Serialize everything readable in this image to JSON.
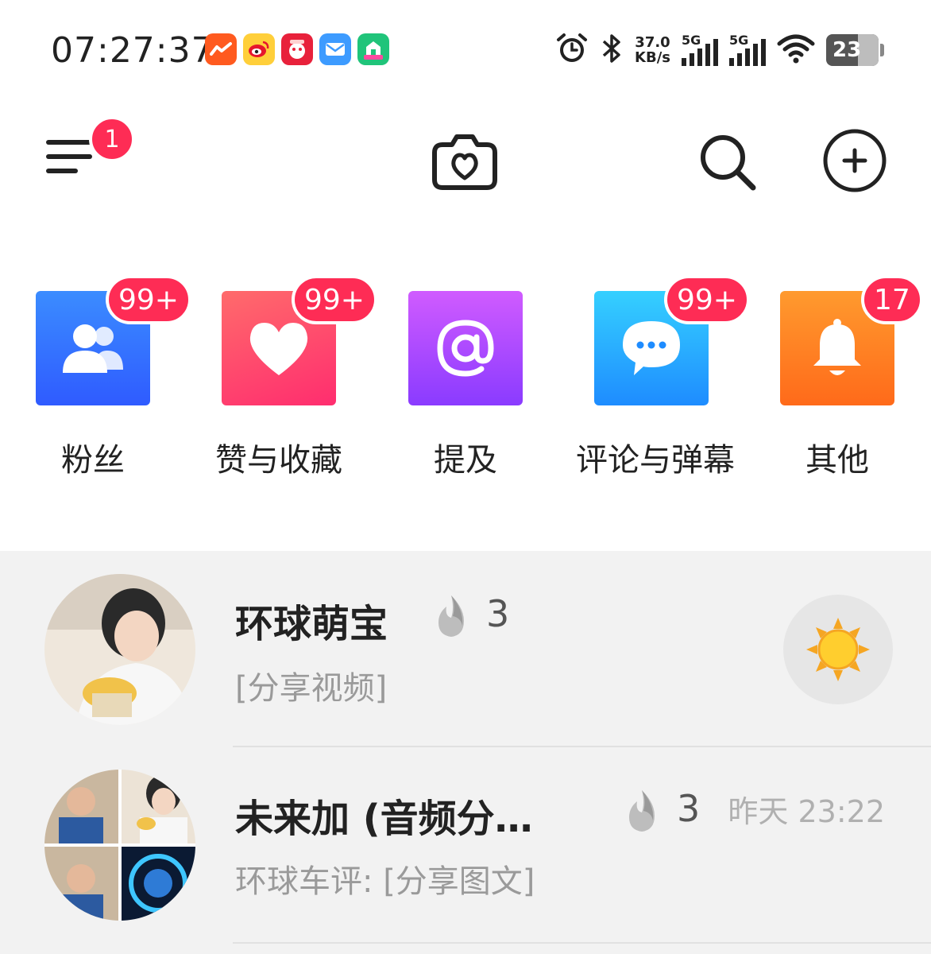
{
  "status_bar": {
    "time": "07:27:37",
    "network_speed_value": "37.0",
    "network_speed_unit": "KB/s",
    "sim1_label": "5G",
    "sim2_label": "5G",
    "battery": "23",
    "notification_icons": [
      "stock-app-icon",
      "weibo-icon",
      "hotel-app-icon",
      "mail-icon",
      "shopping-618-icon"
    ]
  },
  "topnav": {
    "menu_badge": "1",
    "icons": [
      "menu-icon",
      "camera-heart-icon",
      "search-icon",
      "add-circle-icon"
    ]
  },
  "categories": [
    {
      "label": "粉丝",
      "count": "99+",
      "icon": "fans-icon",
      "color_top": "#3b8cff",
      "color_bottom": "#2f5bff"
    },
    {
      "label": "赞与收藏",
      "count": "99+",
      "icon": "heart-icon",
      "color_top": "#ff6b6b",
      "color_bottom": "#ff2d6f"
    },
    {
      "label": "提及",
      "count": "",
      "icon": "at-icon",
      "color_top": "#d05bff",
      "color_bottom": "#8a3bff"
    },
    {
      "label": "评论与弹幕",
      "count": "99+",
      "icon": "comment-icon",
      "color_top": "#35d0ff",
      "color_bottom": "#1e8cff"
    },
    {
      "label": "其他",
      "count": "17",
      "icon": "bell-icon",
      "color_top": "#ff9a2e",
      "color_bottom": "#ff6a1a"
    }
  ],
  "messages": [
    {
      "name": "环球萌宝",
      "fire_count": "3",
      "preview": "[分享视频]",
      "time": "",
      "action_icon": "sun-icon"
    },
    {
      "name": "未来加 (音频分…",
      "fire_count": "3",
      "preview": "环球车评: [分享图文]",
      "time": "昨天 23:22"
    }
  ],
  "colors": {
    "badge_red": "#fe2c55",
    "list_background": "#f2f2f2"
  }
}
